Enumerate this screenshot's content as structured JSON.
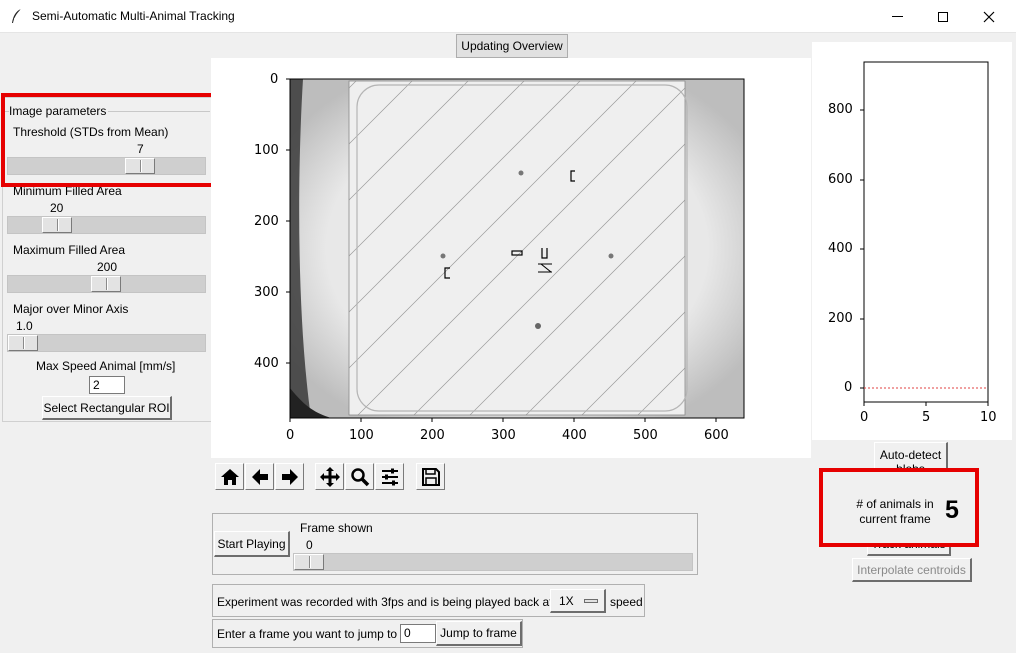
{
  "window": {
    "title": "Semi-Automatic Multi-Animal Tracking",
    "minimize": "—",
    "maximize": "☐",
    "close": "✕"
  },
  "overview_button": "Updating Overview",
  "image_parameters": {
    "group_label": "Image parameters",
    "threshold": {
      "label": "Threshold (STDs from Mean)",
      "value": "7"
    },
    "min_area": {
      "label": "Minimum Filled Area",
      "value": "20"
    },
    "max_area": {
      "label": "Maximum Filled Area",
      "value": "200"
    },
    "axis_ratio": {
      "label": "Major over Minor Axis",
      "value": "1.0"
    },
    "max_speed": {
      "label": "Max Speed Animal [mm/s]",
      "value": "2"
    },
    "roi_button": "Select Rectangular ROI"
  },
  "main_plot": {
    "x_ticks": [
      "0",
      "100",
      "200",
      "300",
      "400",
      "500",
      "600"
    ],
    "y_ticks": [
      "0",
      "100",
      "200",
      "300",
      "400"
    ]
  },
  "right_plot": {
    "y_ticks": [
      "800",
      "600",
      "400",
      "200",
      "0"
    ],
    "x_ticks": [
      "0",
      "5",
      "10"
    ],
    "line_color": "#e04040"
  },
  "toolbar": {
    "icons": [
      "home-icon",
      "back-arrow-icon",
      "forward-arrow-icon",
      "pan-icon",
      "zoom-icon",
      "configure-subplots-icon",
      "save-icon"
    ]
  },
  "playback": {
    "start_button": "Start Playing",
    "frame_label": "Frame shown",
    "frame_value": "0"
  },
  "speed_row": {
    "prefix": "Experiment was recorded with 3fps and is being played back at",
    "speed_value": "1X",
    "suffix": "speed"
  },
  "jump_row": {
    "prefix": "Enter a frame you want to jump to",
    "frame_input": "0",
    "button": "Jump to frame"
  },
  "right_panel": {
    "auto_detect": "Auto-detect blobs",
    "animals_label": "# of animals in current frame",
    "animals_count": "5",
    "track_button": "Track animals",
    "interpolate_button": "Interpolate centroids"
  },
  "colors": {
    "highlight": "#e60000"
  }
}
